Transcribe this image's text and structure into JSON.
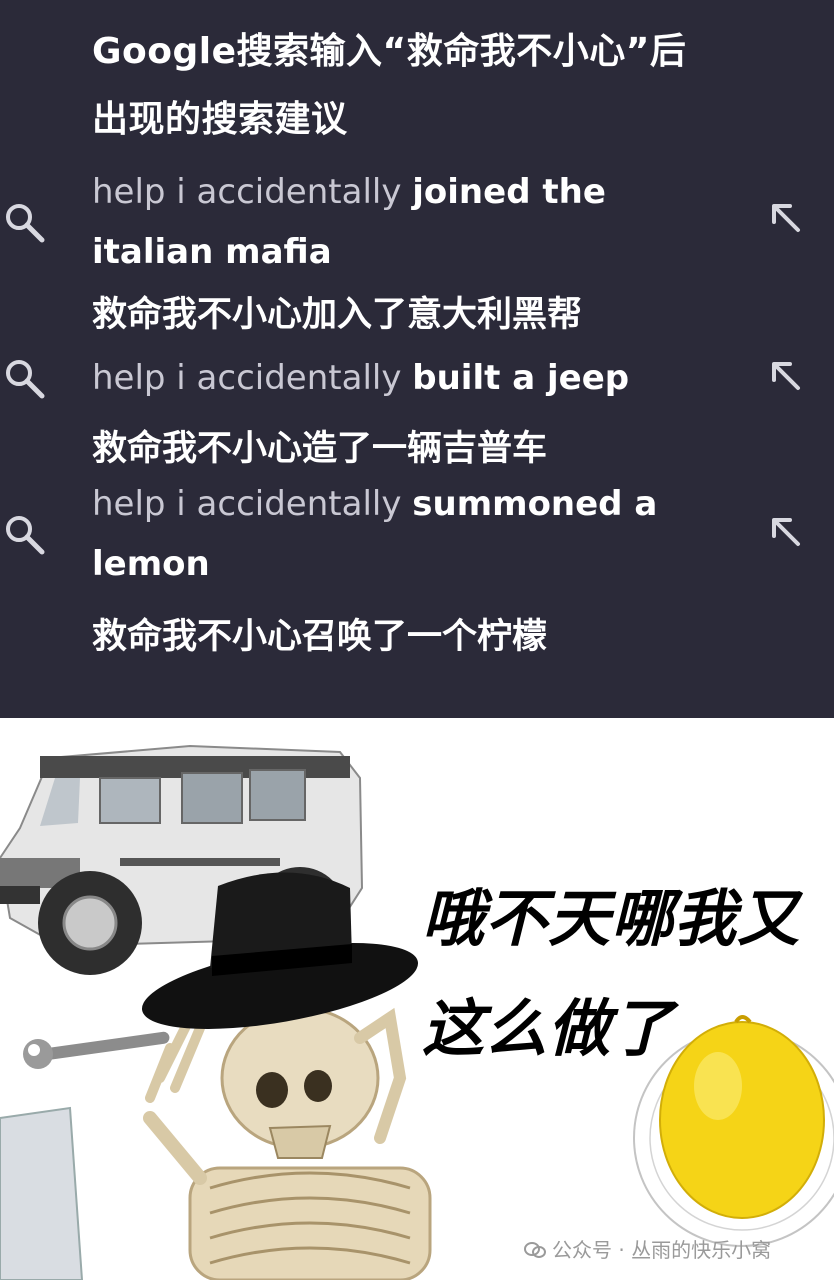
{
  "header": {
    "title_line1": "Google搜索输入“救命我不小心”后",
    "title_line2": "出现的搜索建议"
  },
  "suggestions": [
    {
      "query_prefix": "help i accidentally ",
      "completion": "joined the italian mafia",
      "translation": "救命我不小心加入了意大利黑帮"
    },
    {
      "query_prefix": "help i accidentally ",
      "completion": "built a jeep",
      "translation": "救命我不小心造了一辆吉普车"
    },
    {
      "query_prefix": "help i accidentally ",
      "completion": "summoned a lemon",
      "translation": "救命我不小心召唤了一个柠檬"
    }
  ],
  "icons": {
    "search": "search-icon",
    "fill_query": "arrow-up-left-icon"
  },
  "meme": {
    "caption_line1": "哦不天哪我又",
    "caption_line2": "这么做了"
  },
  "watermark": {
    "text": "公众号 · 丛雨的快乐小窝"
  },
  "colors": {
    "panel_bg": "#2b2a39",
    "text": "#ffffff",
    "lemon": "#f5d417"
  }
}
